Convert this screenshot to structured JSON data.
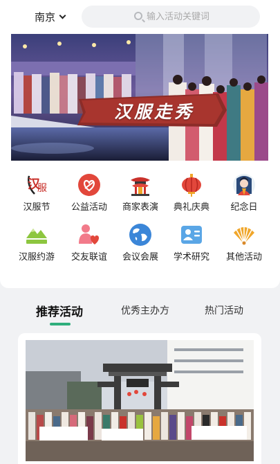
{
  "header": {
    "city": "南京",
    "search_placeholder": "输入活动关键词"
  },
  "banner": {
    "title": "汉服走秀"
  },
  "categories": [
    {
      "label": "汉服节",
      "icon": "hanfu-festival-icon"
    },
    {
      "label": "公益活动",
      "icon": "charity-heart-icon"
    },
    {
      "label": "商家表演",
      "icon": "pavilion-icon"
    },
    {
      "label": "典礼庆典",
      "icon": "lantern-icon"
    },
    {
      "label": "纪念日",
      "icon": "portrait-icon"
    },
    {
      "label": "汉服约游",
      "icon": "mountain-icon"
    },
    {
      "label": "交友联谊",
      "icon": "people-heart-icon"
    },
    {
      "label": "会议会展",
      "icon": "globe-icon"
    },
    {
      "label": "学术研究",
      "icon": "scholar-card-icon"
    },
    {
      "label": "其他活动",
      "icon": "fan-icon"
    }
  ],
  "tabs": [
    {
      "label": "推荐活动",
      "active": true
    },
    {
      "label": "优秀主办方",
      "active": false
    },
    {
      "label": "热门活动",
      "active": false
    }
  ],
  "colors": {
    "accent": "#2fae7c",
    "red": "#e2473b",
    "blue": "#3b86d8",
    "gold": "#f0a62a"
  }
}
